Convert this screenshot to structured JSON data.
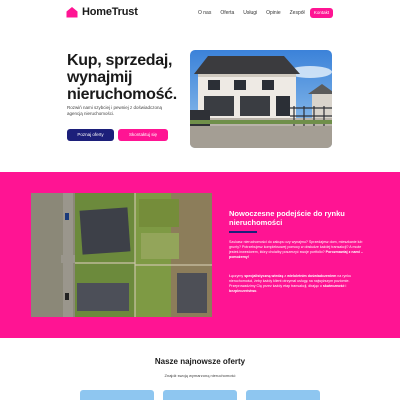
{
  "brand": {
    "name": "HomeTrust",
    "color": "#ff1493",
    "dark": "#1c1f7a"
  },
  "nav": {
    "items": [
      "O nas",
      "Oferta",
      "Usługi",
      "Opinie",
      "Zespół"
    ],
    "contact": "Kontakt"
  },
  "hero": {
    "title": "Kup, sprzedaj, wynajmij nieruchomość.",
    "subtitle": "Rozwiń nami szybciej i pewniej z doświadczoną agencją nieruchomości.",
    "primary_button": "Poznaj oferty",
    "secondary_button": "Skontaktuj się"
  },
  "about": {
    "title": "Nowoczesne podejście do rynku nieruchomości",
    "p1": "Szukasz nieruchomości do zakupu czy wynajmu? Sprzedajesz dom, mieszkanie lub grunty? Potrzebujesz kompleksowej pomocy w obsłudze każdej transakcji? A może jesteś inwestorem, który chciałby poszerzyć swoje portfolio?",
    "p1_bold": "Porozmawiaj z nami – pomożemy!",
    "p2_start": "Łączymy",
    "p2_bold1": "specjalistyczną wiedzę",
    "p2_mid1": "z",
    "p2_bold2": "wieloletnim doświadczeniem",
    "p2_mid2": "na rynku nieruchomości, żeby każdy klient otrzymał usługę na najwyższym poziomie. Przeprowadzimy Cię przez każdy etap transakcji, dbając o",
    "p2_bold3": "skuteczność",
    "p2_mid3": "i",
    "p2_bold4": "bezpieczeństwo",
    "p2_end": "."
  },
  "offers": {
    "title": "Nasze najnowsze oferty",
    "subtitle": "Znajdź swoją wymarzoną nieruchomość"
  }
}
